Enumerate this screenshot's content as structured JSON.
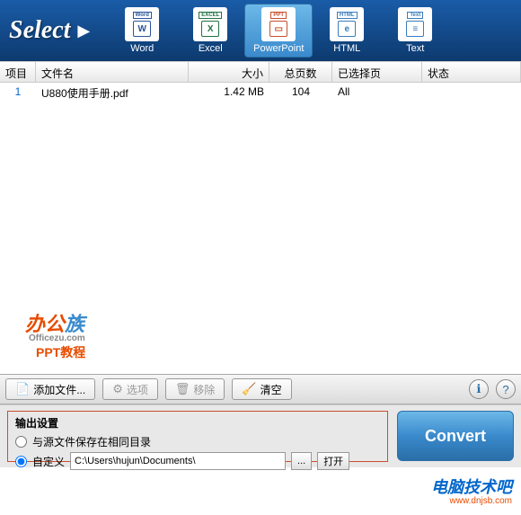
{
  "toolbar": {
    "select_label": "Select",
    "formats": [
      {
        "name": "Word",
        "tag": "Word",
        "selected": false
      },
      {
        "name": "Excel",
        "tag": "EXCEL",
        "selected": false
      },
      {
        "name": "PowerPoint",
        "tag": "PPT",
        "selected": true
      },
      {
        "name": "HTML",
        "tag": "HTML",
        "selected": false
      },
      {
        "name": "Text",
        "tag": "Text",
        "selected": false
      }
    ]
  },
  "table": {
    "headers": {
      "index": "项目",
      "filename": "文件名",
      "size": "大小",
      "total_pages": "总页数",
      "selected_pages": "已选择页",
      "status": "状态"
    },
    "rows": [
      {
        "index": "1",
        "filename": "U880使用手册.pdf",
        "size": "1.42 MB",
        "total_pages": "104",
        "selected_pages": "All",
        "status": ""
      }
    ]
  },
  "watermarks": {
    "wm1_part1": "办公",
    "wm1_part2": "族",
    "wm1_sub": "Officezu.com",
    "wm1_line2": "PPT教程",
    "wm2_line1": "电脑技术吧",
    "wm2_line2": "www.dnjsb.com"
  },
  "actions": {
    "add_file": "添加文件...",
    "options": "选项",
    "remove": "移除",
    "clear": "清空"
  },
  "output": {
    "title": "输出设置",
    "same_dir": "与源文件保存在相同目录",
    "custom": "自定义",
    "path": "C:\\Users\\hujun\\Documents\\",
    "browse": "...",
    "open": "打开"
  },
  "convert": {
    "label": "Convert"
  }
}
